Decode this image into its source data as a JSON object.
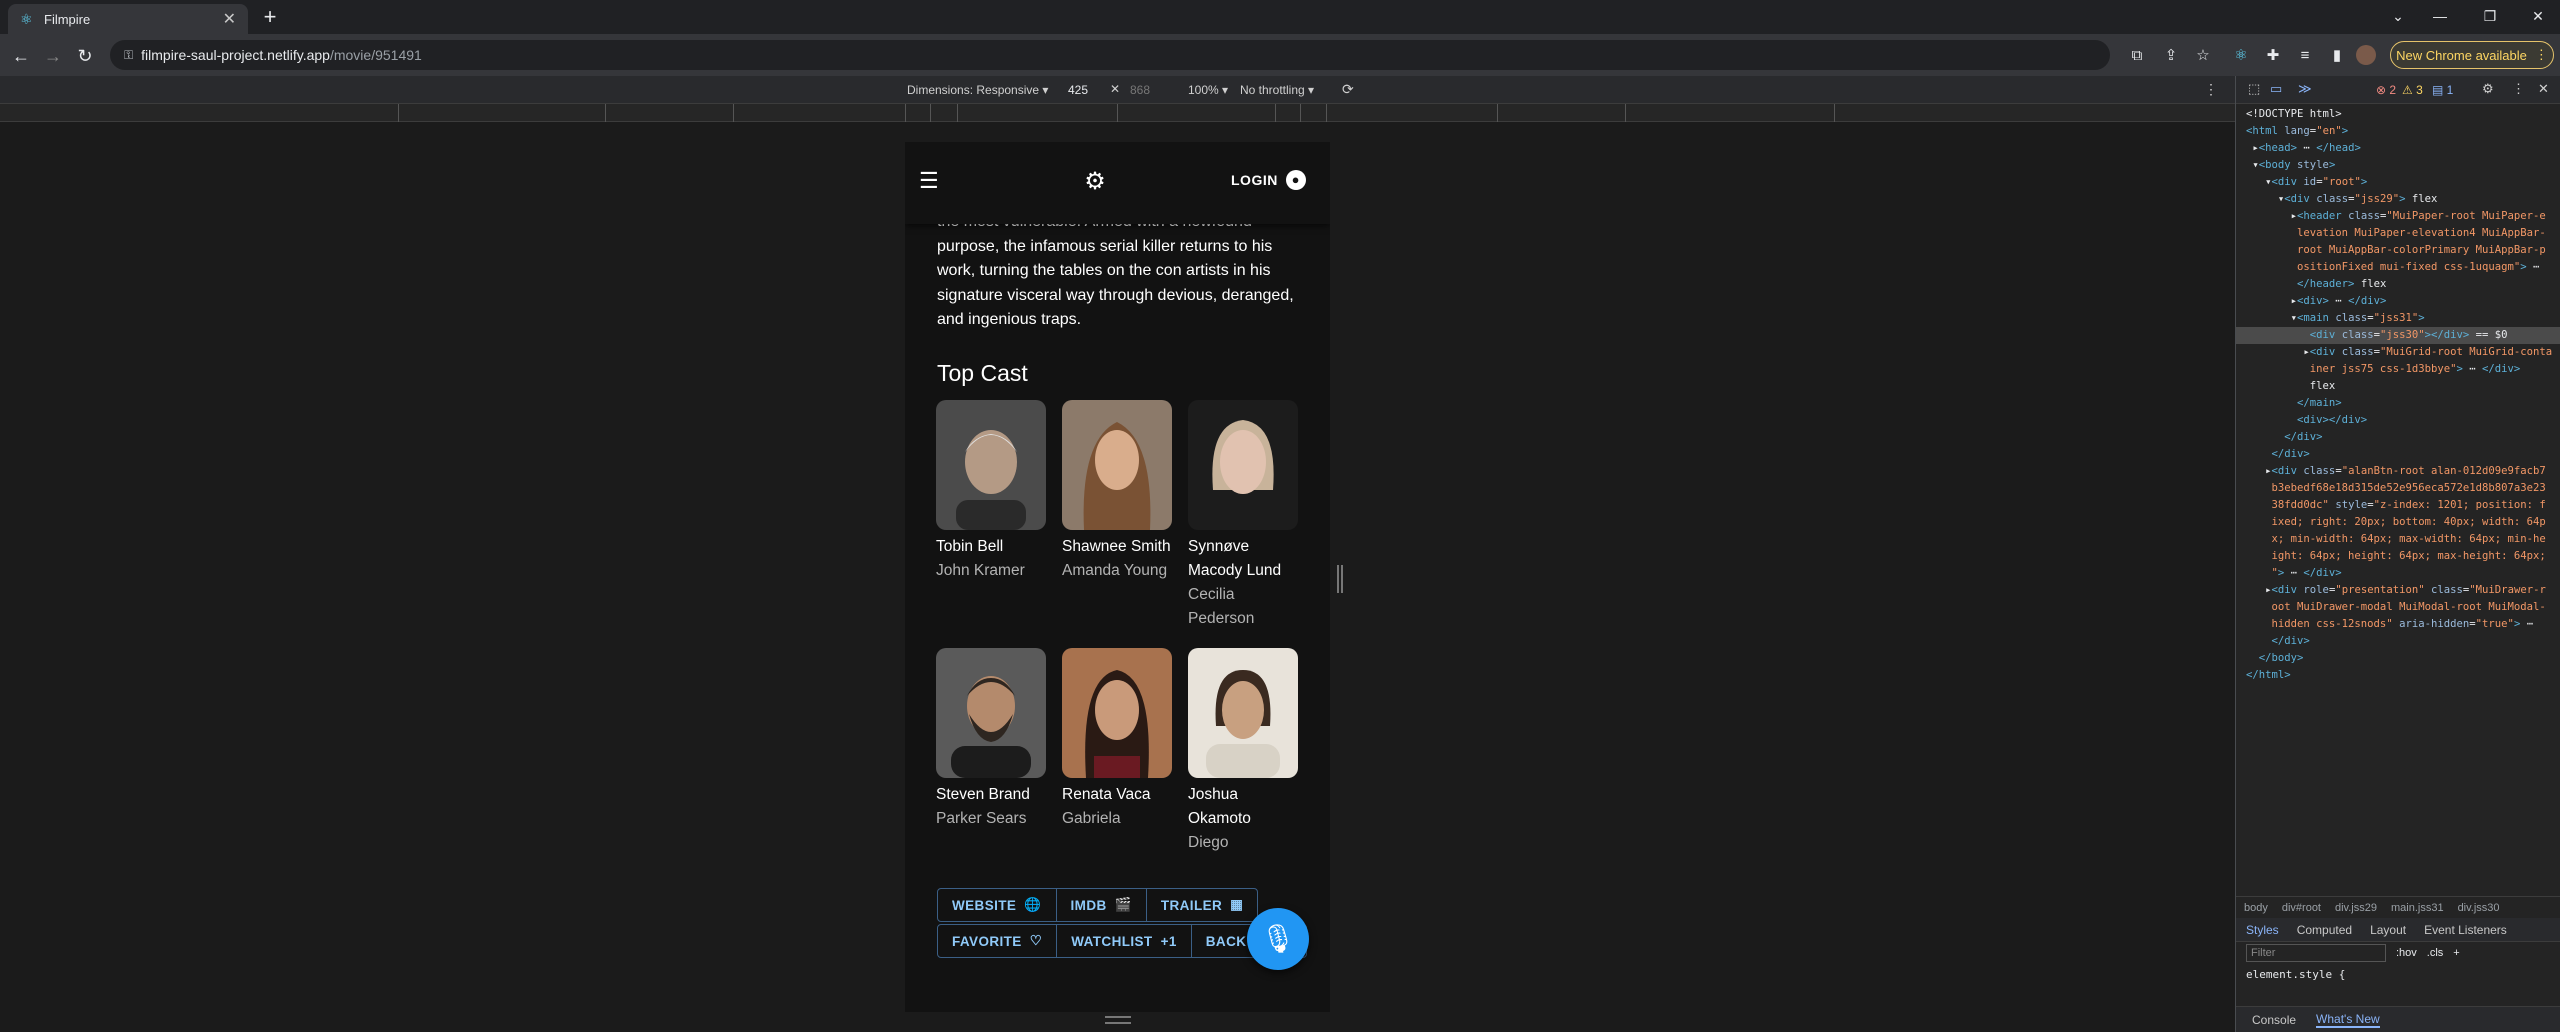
{
  "browser": {
    "tab_title": "Filmpire",
    "url_host": "filmpire-saul-project.netlify.app",
    "url_path": "/movie/951491",
    "update_label": "New Chrome available"
  },
  "device_toolbar": {
    "dimensions": "Dimensions: Responsive",
    "width": "425",
    "height": "868",
    "zoom": "100%",
    "throttling": "No throttling"
  },
  "app": {
    "login_label": "LOGIN",
    "plot": "the most vulnerable. Armed with a newfound purpose, the infamous serial killer returns to his work, turning the tables on the con artists in his signature visceral way through devious, deranged, and ingenious traps.",
    "top_cast_title": "Top Cast",
    "cast": [
      {
        "name": "Tobin Bell",
        "role": "John Kramer",
        "skin": "#b49a85",
        "hair": "#e0e0e0",
        "bg": "#4b4b4b"
      },
      {
        "name": "Shawnee Smith",
        "role": "Amanda Young",
        "skin": "#d9ad8c",
        "hair": "#7a5234",
        "bg": "#8c7a6a"
      },
      {
        "name": "Synnøve Macody Lund",
        "role": "Cecilia Pederson",
        "skin": "#e1c2b0",
        "hair": "#c8b39a",
        "bg": "#1c1c1c"
      },
      {
        "name": "Steven Brand",
        "role": "Parker Sears",
        "skin": "#b48a6c",
        "hair": "#2e2620",
        "bg": "#5a5a5a"
      },
      {
        "name": "Renata Vaca",
        "role": "Gabriela",
        "skin": "#c99a7a",
        "hair": "#2a1a14",
        "bg": "#a8724e"
      },
      {
        "name": "Joshua Okamoto",
        "role": "Diego",
        "skin": "#c8a080",
        "hair": "#3a2a20",
        "bg": "#e8e3da"
      }
    ],
    "buttons_row1": [
      {
        "label": "WEBSITE",
        "icon": "🌐"
      },
      {
        "label": "IMDB",
        "icon": "🎬"
      },
      {
        "label": "TRAILER",
        "icon": "▦"
      }
    ],
    "buttons_row2": [
      {
        "label": "FAVORITE",
        "icon": "♡"
      },
      {
        "label": "WATCHLIST",
        "icon": "+1"
      },
      {
        "label": "BACK",
        "icon": ""
      }
    ]
  },
  "devtools": {
    "errors": "2",
    "warnings": "3",
    "issues": "1",
    "breadcrumbs": [
      "body",
      "div#root",
      "div.jss29",
      "main.jss31",
      "div.jss30"
    ],
    "styles_tabs": [
      "Styles",
      "Computed",
      "Layout",
      "Event Listeners"
    ],
    "filter_placeholder": "Filter",
    "hov": ":hov",
    "cls": ".cls",
    "element_style": "element.style {",
    "drawer_tabs": [
      "Console",
      "What's New"
    ]
  }
}
